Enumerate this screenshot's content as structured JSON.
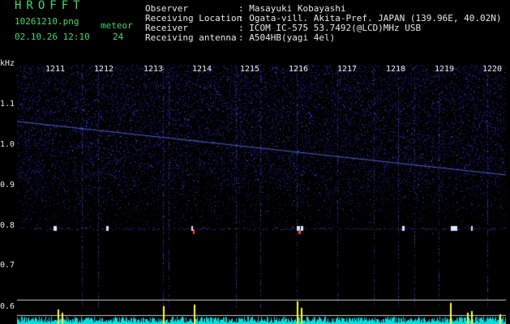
{
  "app": {
    "logo": "HROFFT",
    "filename": "10261210.png",
    "datetime": "02.10.26 12:10",
    "meteor_label": "meteor",
    "meteor_count": "24"
  },
  "info": {
    "labels": [
      "Observer",
      "Receiving Location",
      "Receiver",
      "Receiving antenna"
    ],
    "values": [
      ": Masayuki Kobayashi",
      ": Ogata-vill. Akita-Pref. JAPAN (139.96E, 40.02N)",
      ": ICOM IC-575 53.7492(@LCD)MHz USB",
      ": A504HB(yagi 4el)"
    ]
  },
  "plot": {
    "y_unit": "kHz",
    "y_ticks": [
      "1.1",
      "1.0",
      "0.9",
      "0.8",
      "0.7",
      "0.6"
    ],
    "x_ticks": [
      "1211",
      "1212",
      "1213",
      "1214",
      "1215",
      "1216",
      "1217",
      "1218",
      "1219",
      "1220"
    ],
    "colors": {
      "background": "#000000",
      "noise": "#1e2a9e",
      "noise_bright": "#4a5cff",
      "echo": "#cfe8ff",
      "echo_hot": "#ff4040",
      "baseline": "#00e0e0",
      "peak": "#ffff40",
      "divider": "#c8c8c8"
    }
  }
}
